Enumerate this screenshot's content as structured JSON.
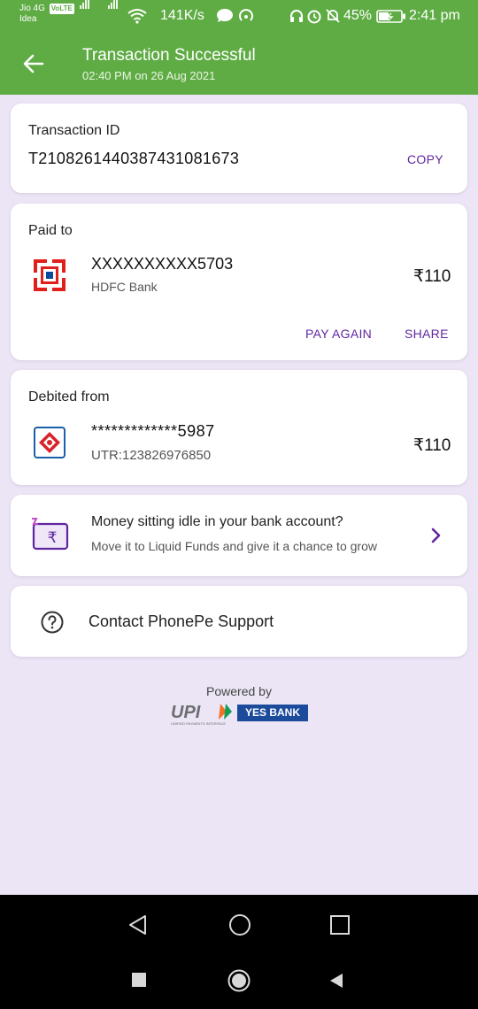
{
  "status_bar": {
    "carrier_line1": "Jio 4G",
    "volte_badge": "VoLTE",
    "carrier_line2": "Idea",
    "net_speed": "141K/s",
    "battery": "45%",
    "time": "2:41 pm"
  },
  "header": {
    "title": "Transaction Successful",
    "subtitle": "02:40 PM on 26 Aug 2021"
  },
  "transaction": {
    "label": "Transaction ID",
    "id": "T2108261440387431081673",
    "copy_label": "COPY"
  },
  "paid_to": {
    "label": "Paid to",
    "account": "XXXXXXXXXX5703",
    "bank": "HDFC Bank",
    "amount": "₹110",
    "pay_again_label": "PAY AGAIN",
    "share_label": "SHARE"
  },
  "debited_from": {
    "label": "Debited from",
    "account": "*************5987",
    "utr": "UTR:123826976850",
    "amount": "₹110"
  },
  "promo": {
    "title": "Money sitting idle in your bank account?",
    "subtitle": "Move it to Liquid Funds and give it a chance to grow",
    "icon_glyph": "₹"
  },
  "support": {
    "label": "Contact PhonePe Support"
  },
  "footer": {
    "powered_by": "Powered by",
    "upi_text": "UPI",
    "upi_tagline": "UNIFIED PAYMENTS INTERFACE",
    "bank_logo_text": "YES BANK"
  },
  "colors": {
    "header_green": "#5fac45",
    "accent_purple": "#5f259f",
    "background_lavender": "#ece5f5",
    "hdfc_red": "#e0201b",
    "hdfc_blue": "#0a4a9c",
    "sbi_blue": "#1a5fa8",
    "yes_bank_blue": "#1c4b9c"
  },
  "icons": {
    "back": "arrow-left-icon",
    "hdfc": "hdfc-logo",
    "debit_bank": "bank-logo",
    "promo": "wallet-rupee-icon",
    "chevron": "chevron-right-icon",
    "help": "question-circle-icon"
  }
}
